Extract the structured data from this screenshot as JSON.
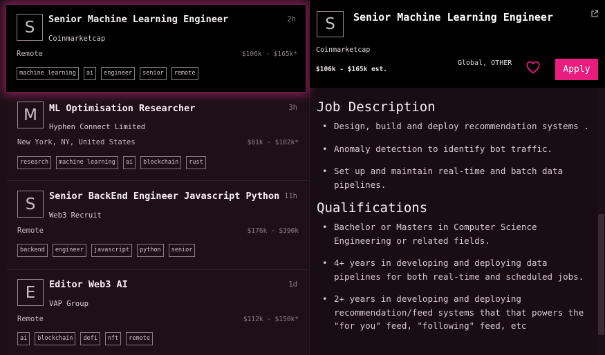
{
  "jobs": [
    {
      "logo_letter": "S",
      "title": "Senior Machine Learning Engineer",
      "company": "Coinmarketcap",
      "age": "2h",
      "location": "Remote",
      "salary": "$106k - $165k*",
      "tags": [
        "machine learning",
        "ai",
        "engineer",
        "senior",
        "remote"
      ]
    },
    {
      "logo_letter": "M",
      "title": "ML Optimisation Researcher",
      "company": "Hyphen Connect Limited",
      "age": "3h",
      "location": "New York, NY, United States",
      "salary": "$81k - $102k*",
      "tags": [
        "research",
        "machine learning",
        "ai",
        "blockchain",
        "rust"
      ]
    },
    {
      "logo_letter": "S",
      "title": "Senior BackEnd Engineer Javascript Python",
      "company": "Web3 Recruit",
      "age": "11h",
      "location": "Remote",
      "salary": "$176k - $390k",
      "tags": [
        "backend",
        "engineer",
        "javascript",
        "python",
        "senior"
      ]
    },
    {
      "logo_letter": "E",
      "title": "Editor Web3 AI",
      "company": "VAP Group",
      "age": "1d",
      "location": "Remote",
      "salary": "$112k - $150k*",
      "tags": [
        "ai",
        "blockchain",
        "defi",
        "nft",
        "remote"
      ]
    }
  ],
  "detail": {
    "logo_letter": "S",
    "title": "Senior Machine Learning Engineer",
    "company": "Coinmarketcap",
    "salary": "$106k - $165k est.",
    "location": "Global, OTHER",
    "apply_label": "Apply",
    "sections": [
      {
        "heading": "Job Description",
        "items": [
          "Design, build and deploy recommendation systems .",
          "Anomaly detection to identify bot traffic.",
          "Set up and maintain real-time and batch data pipelines."
        ]
      },
      {
        "heading": "Qualifications",
        "items": [
          "Bachelor or Masters in Computer Science Engineering or related fields.",
          "4+ years in developing and deploying data pipelines for both real-time and scheduled jobs.",
          "2+ years in developing and deploying recommendation/feed systems that that powers the \"for you\" feed, \"following\" feed, etc"
        ]
      }
    ]
  },
  "colors": {
    "accent": "#ea1d7e",
    "glow": "#e22d8c",
    "background": "#180c13"
  },
  "icons": {
    "external_link": "external-link-icon",
    "favorite": "heart-icon"
  }
}
